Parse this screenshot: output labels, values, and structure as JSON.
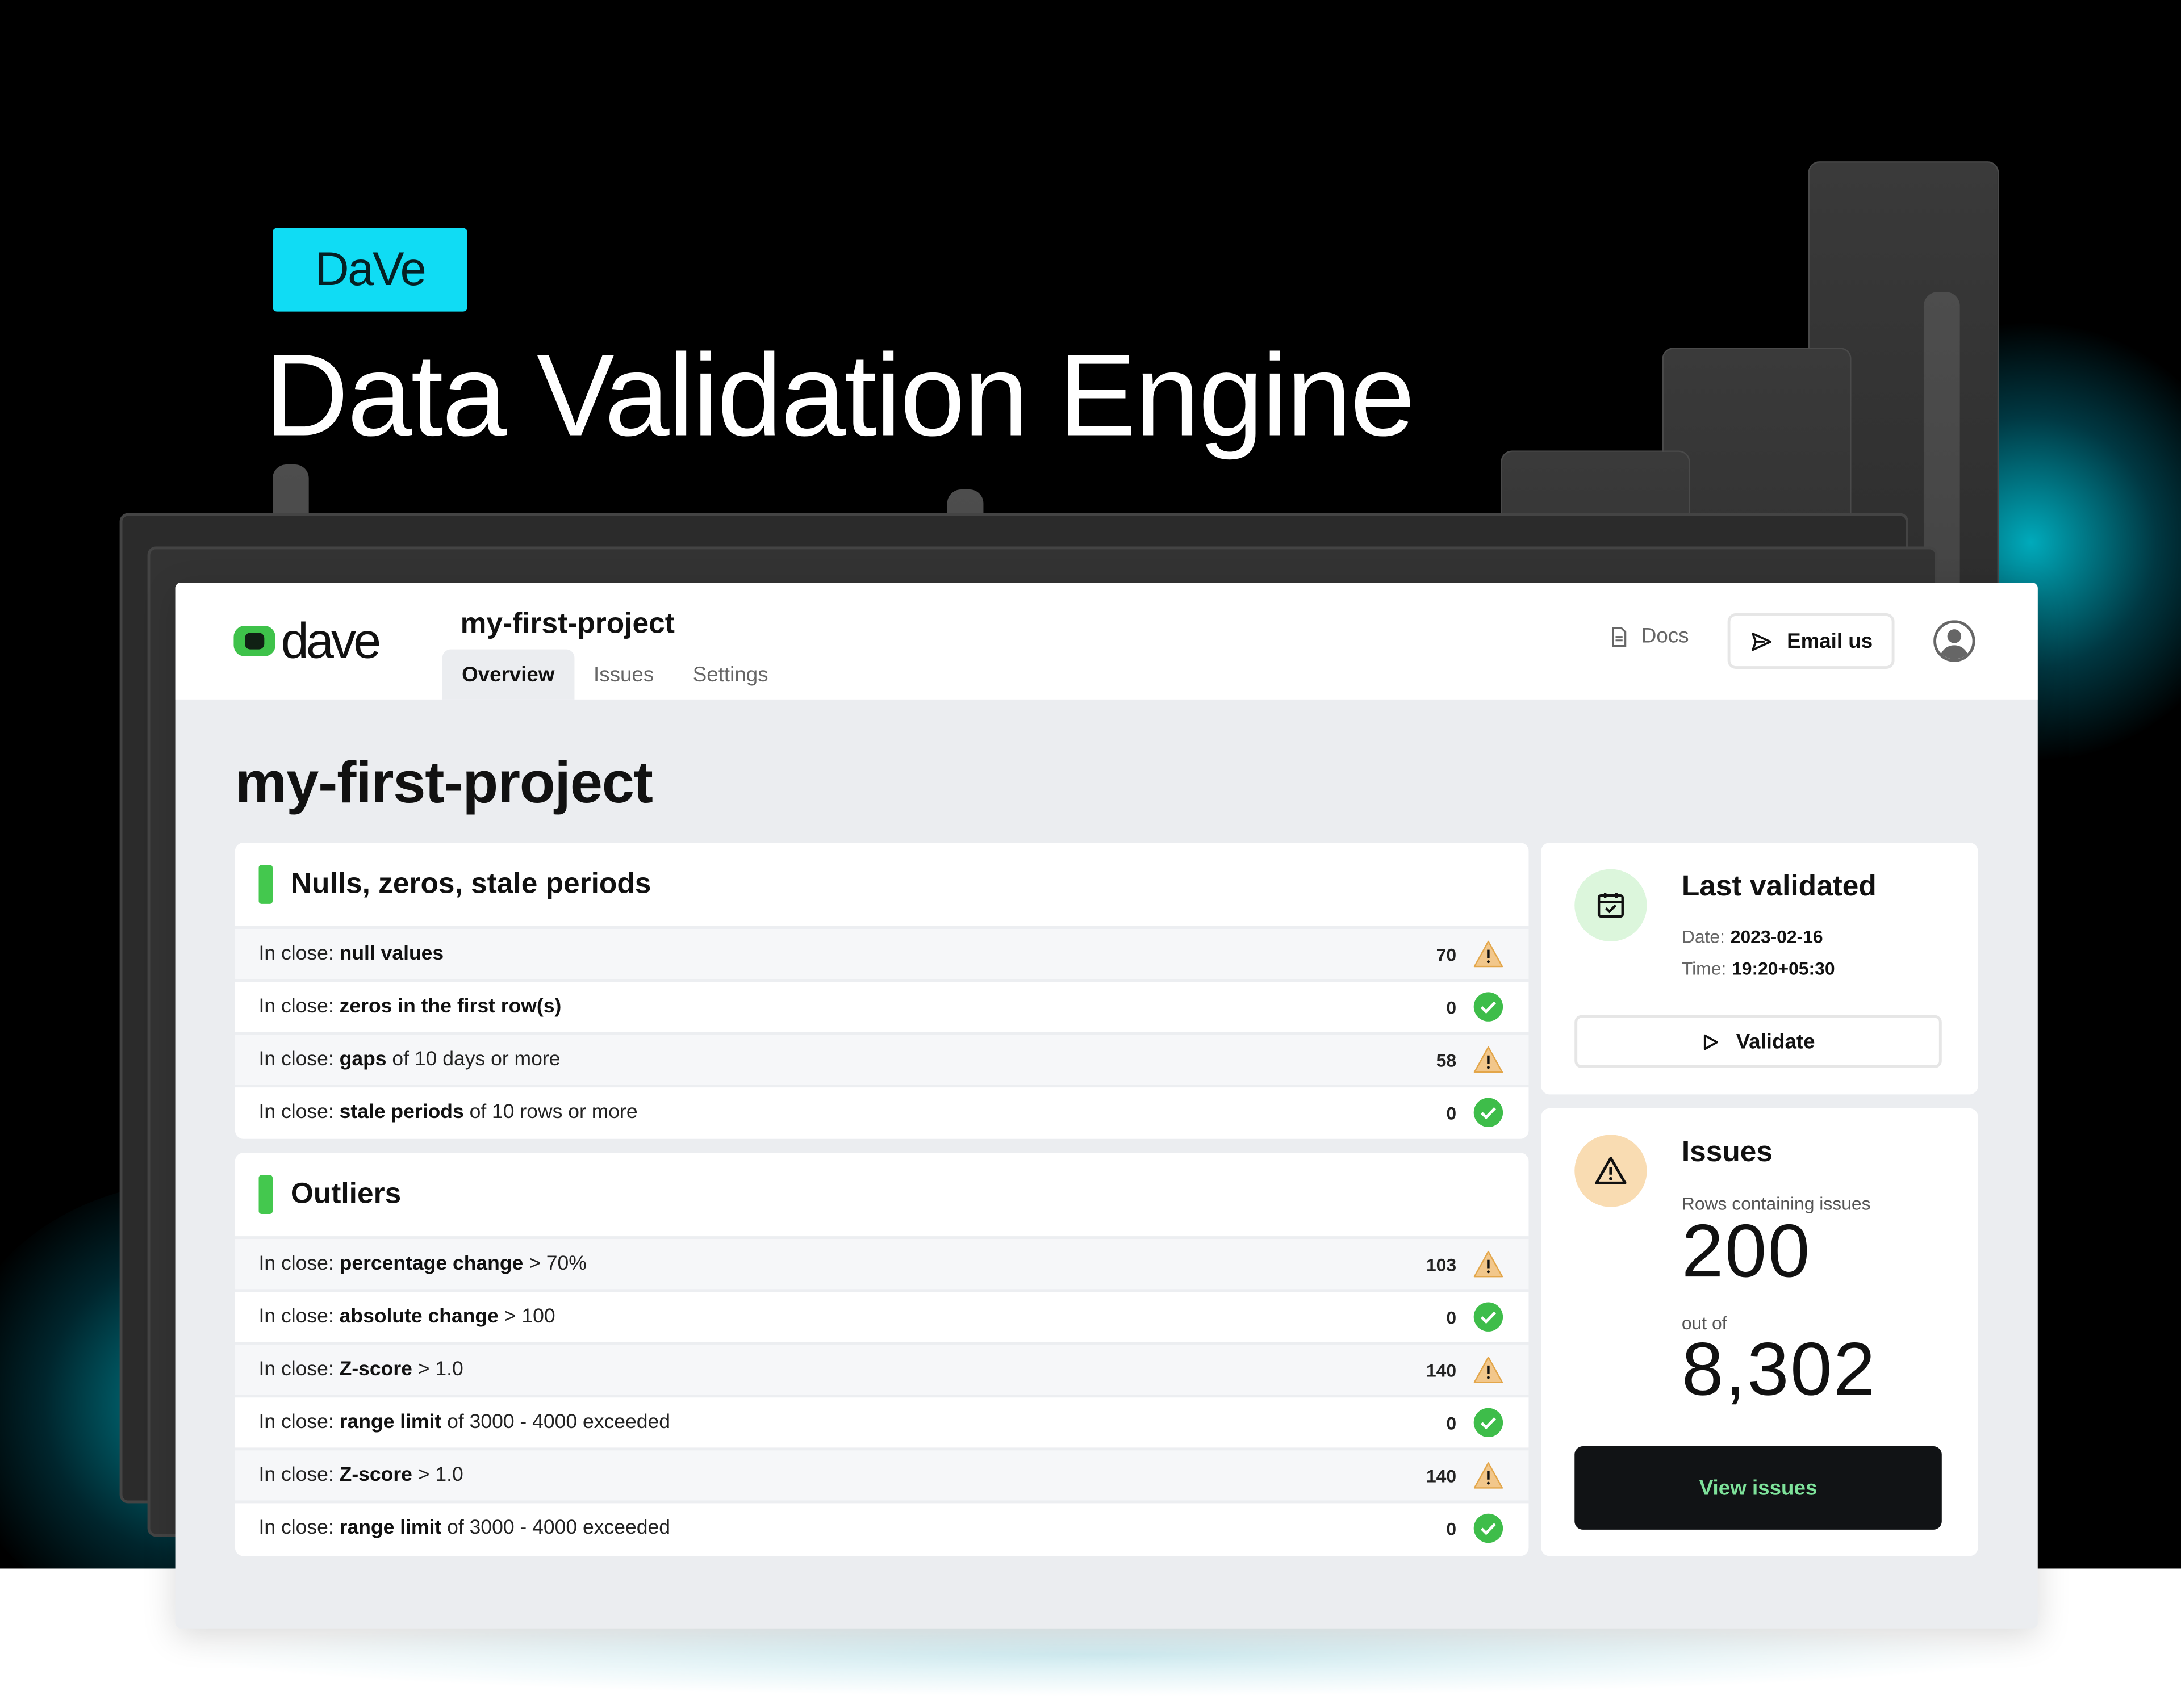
{
  "hero": {
    "badge": "DaVe",
    "title": "Data Validation Engine"
  },
  "brand": {
    "logo_text": "dave",
    "accent": "#10dcf4",
    "ok_green": "#44c84e",
    "warn_orange": "#e8a43a"
  },
  "topbar": {
    "project_name": "my-first-project",
    "tabs": [
      {
        "label": "Overview",
        "active": true
      },
      {
        "label": "Issues",
        "active": false
      },
      {
        "label": "Settings",
        "active": false
      }
    ],
    "docs_label": "Docs",
    "email_label": "Email us",
    "docs_icon": "document-icon",
    "email_icon": "send-icon",
    "avatar_icon": "user-avatar-icon"
  },
  "page": {
    "title": "my-first-project"
  },
  "sections": [
    {
      "title": "Nulls, zeros, stale periods",
      "rows": [
        {
          "prefix": "In close:",
          "bold": "null values",
          "suffix": "",
          "count": "70",
          "status": "warning"
        },
        {
          "prefix": "In close:",
          "bold": "zeros in the first row(s)",
          "suffix": "",
          "count": "0",
          "status": "ok"
        },
        {
          "prefix": "In close:",
          "bold": "gaps",
          "suffix": "of 10 days or more",
          "count": "58",
          "status": "warning"
        },
        {
          "prefix": "In close:",
          "bold": "stale periods",
          "suffix": "of 10 rows or more",
          "count": "0",
          "status": "ok"
        }
      ]
    },
    {
      "title": "Outliers",
      "rows": [
        {
          "prefix": "In close:",
          "bold": "percentage change",
          "suffix": "> 70%",
          "count": "103",
          "status": "warning"
        },
        {
          "prefix": "In close:",
          "bold": "absolute change",
          "suffix": "> 100",
          "count": "0",
          "status": "ok"
        },
        {
          "prefix": "In close:",
          "bold": "Z-score",
          "suffix": "> 1.0",
          "count": "140",
          "status": "warning"
        },
        {
          "prefix": "In close:",
          "bold": "range limit",
          "suffix": "of 3000 - 4000 exceeded",
          "count": "0",
          "status": "ok"
        },
        {
          "prefix": "In close:",
          "bold": "Z-score",
          "suffix": "> 1.0",
          "count": "140",
          "status": "warning"
        },
        {
          "prefix": "In close:",
          "bold": "range limit",
          "suffix": "of 3000 - 4000 exceeded",
          "count": "0",
          "status": "ok"
        }
      ]
    }
  ],
  "last_validated": {
    "title": "Last validated",
    "date_label": "Date:",
    "date_value": "2023-02-16",
    "time_label": "Time:",
    "time_value": "19:20+05:30",
    "button_label": "Validate",
    "icon": "calendar-check-icon"
  },
  "issues": {
    "title": "Issues",
    "rows_label": "Rows containing issues",
    "rows_value": "200",
    "out_of_label": "out of",
    "total_value": "8,302",
    "button_label": "View issues",
    "icon": "warning-triangle-icon"
  }
}
